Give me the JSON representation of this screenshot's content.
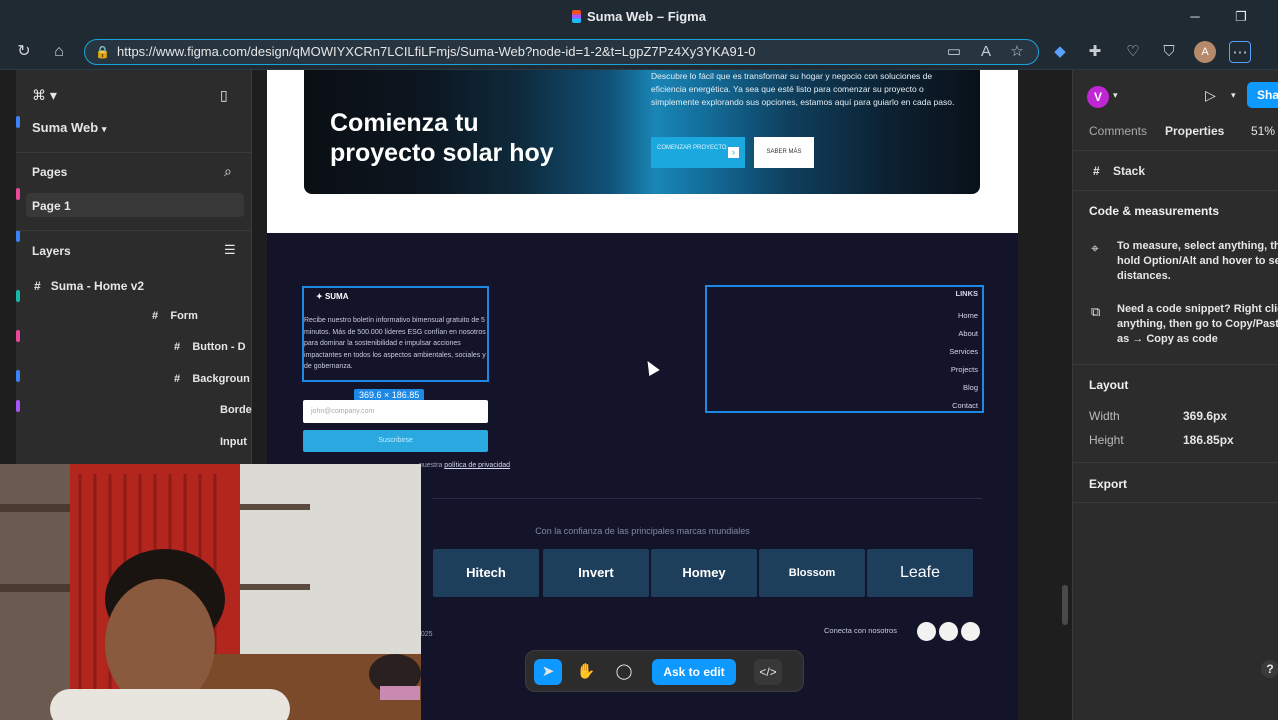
{
  "browser": {
    "window_title": "Suma Web – Figma",
    "url": "https://www.figma.com/design/qMOWIYXCRn7LCILfiLFmjs/Suma-Web?node-id=1-2&t=LgpZ7Pz4Xy3YKA91-0",
    "avatar_initial": "A"
  },
  "left_panel": {
    "file_name": "Suma Web",
    "pages_heading": "Pages",
    "current_page": "Page 1",
    "layers_heading": "Layers",
    "layers": [
      {
        "label": "Suma - Home v2"
      },
      {
        "label": "Form"
      },
      {
        "label": "Button - D"
      },
      {
        "label": "Backgroun"
      },
      {
        "label": "Borde"
      },
      {
        "label": "Input"
      }
    ]
  },
  "canvas": {
    "cta": {
      "headline": "Comienza tu proyecto solar hoy",
      "description": "Descubre lo fácil que es transformar su hogar y negocio con soluciones de eficiencia energética. Ya sea que esté listo para comenzar su proyecto o simplemente explorando sus opciones, estamos aquí para guiarlo en cada paso.",
      "primary_button": "COMENZAR PROYECTO",
      "secondary_button": "SABER MÁS"
    },
    "footer": {
      "logo_text": "SUMA",
      "newsletter_text": "Recibe nuestro boletín informativo bimensual gratuito de 5 minutos. Más de 500.000 líderes ESG confían en nosotros para dominar la sostenibilidad e impulsar acciones impactantes en todos los aspectos ambientales, sociales y de gobernanza.",
      "selection_size": "369.6 × 186.85",
      "email_placeholder": "john@company.com",
      "subscribe_label": "Suscribirse",
      "privacy_prefix": "nuestra ",
      "privacy_link": "política de privacidad",
      "links_heading": "LINKS",
      "links": [
        "Home",
        "About",
        "Services",
        "Projects",
        "Blog",
        "Contact"
      ],
      "trusted_text": "Con la confianza de las principales marcas mundiales",
      "brands": [
        "Hitech",
        "Invert",
        "Homey",
        "Blossom",
        "Leafe"
      ],
      "copyright": "2025",
      "connect_text": "Conecta con nosotros"
    }
  },
  "toolbar": {
    "ask_to_edit": "Ask to edit",
    "code_icon": "</>"
  },
  "right_panel": {
    "user_initial": "V",
    "share_label": "Sha",
    "tab_comments": "Comments",
    "tab_properties": "Properties",
    "zoom": "51%",
    "selection_type": "Stack",
    "code_measurements_heading": "Code & measurements",
    "measure_tip": "To measure, select anything, th hold Option/Alt and hover to se distances.",
    "snippet_tip": "Need a code snippet? Right clic anything, then go to Copy/Past as → Copy as code",
    "layout_heading": "Layout",
    "width_label": "Width",
    "width_value": "369.6px",
    "height_label": "Height",
    "height_value": "186.85px",
    "export_heading": "Export",
    "help": "?"
  },
  "colors": {
    "figma_panel": "#2c2c2c",
    "selection_blue": "#1e88e5",
    "footer_bg": "#13132a",
    "cta_accent": "#1ba8de",
    "user_avatar": "#c026d3"
  }
}
